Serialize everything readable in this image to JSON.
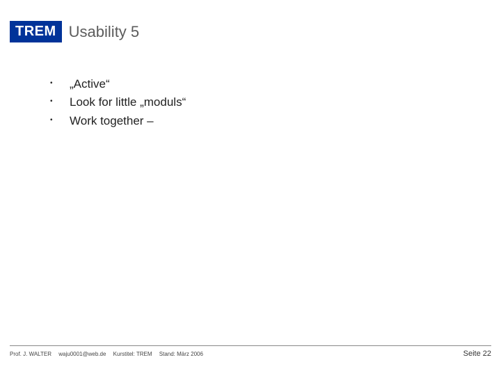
{
  "header": {
    "badge": "TREM",
    "title": "Usability 5"
  },
  "bullets": [
    "„Active“",
    "Look for little „moduls“",
    "Work together –"
  ],
  "footer": {
    "author": "Prof. J. WALTER",
    "email": "waju0001@web.de",
    "course": "Kurstitel: TREM",
    "date": "Stand: März 2006",
    "page": "Seite 22"
  }
}
